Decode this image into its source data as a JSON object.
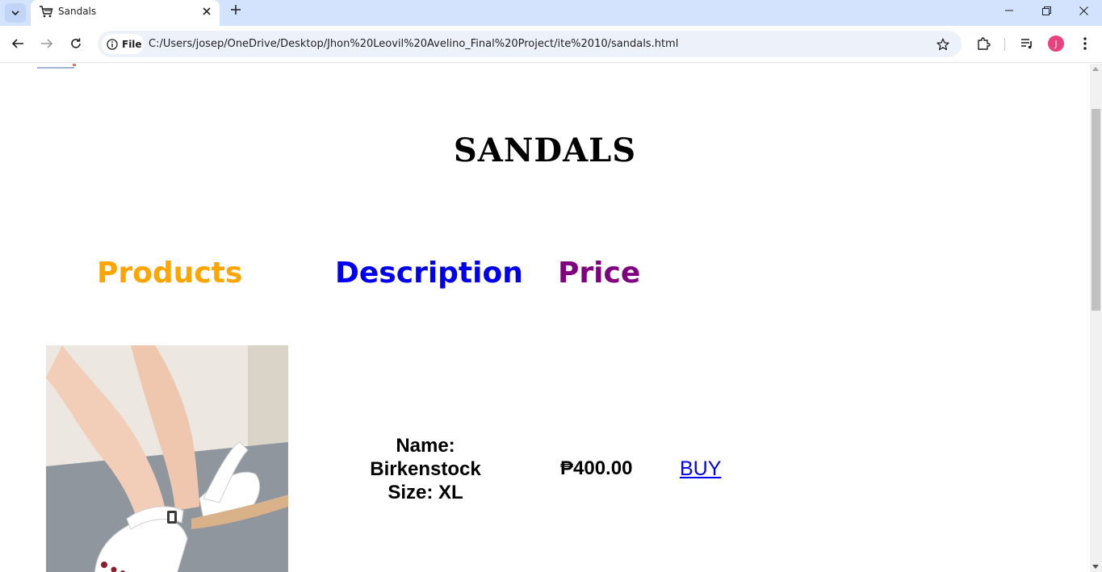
{
  "browser": {
    "tab_title": "Sandals",
    "url_chip_label": "File",
    "url": "C:/Users/josep/OneDrive/Desktop/Jhon%20Leovil%20Avelino_Final%20Project/ite%2010/sandals.html",
    "avatar_initial": "J"
  },
  "page": {
    "title": "SANDALS",
    "headers": {
      "products": "Products",
      "description": "Description",
      "price": "Price"
    },
    "product": {
      "name_line": "Name:",
      "name_value": "Birkenstock",
      "size_line": "Size: XL",
      "price": "₱400.00",
      "buy_label": "BUY",
      "image_icon": "white-sandal-photo"
    }
  },
  "colors": {
    "products_header": "#ffa500",
    "description_header": "#0000ee",
    "price_header": "#800080",
    "link": "#0000ee",
    "tabstrip": "#d3e3fd",
    "avatar": "#e8437f"
  }
}
